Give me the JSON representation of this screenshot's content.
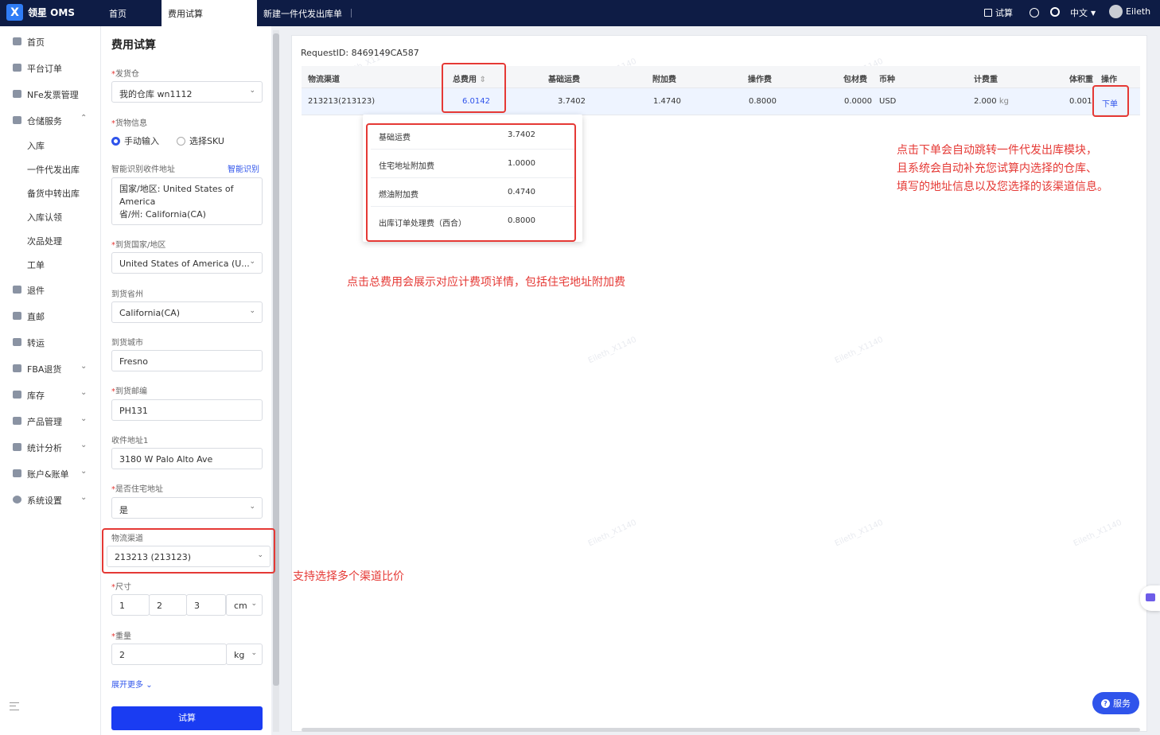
{
  "app": {
    "logo_mark": "X",
    "name": "领星 OMS"
  },
  "tabs": [
    {
      "label": "首页"
    },
    {
      "label": "费用试算",
      "active": true
    },
    {
      "label": "新建一件代发出库单"
    }
  ],
  "topright": {
    "calc_label": "试算",
    "lang": "中文",
    "user": "Eileth"
  },
  "sidebar": {
    "items": [
      {
        "label": "首页",
        "icon": "home-icon"
      },
      {
        "label": "平台订单",
        "icon": "order-icon"
      },
      {
        "label": "NFe发票管理",
        "icon": "invoice-icon"
      },
      {
        "label": "仓储服务",
        "icon": "warehouse-icon",
        "expanded": true
      },
      {
        "label": "入库"
      },
      {
        "label": "一件代发出库"
      },
      {
        "label": "备货中转出库"
      },
      {
        "label": "入库认领"
      },
      {
        "label": "次品处理"
      },
      {
        "label": "工单"
      },
      {
        "label": "退件",
        "icon": "return-icon"
      },
      {
        "label": "直邮",
        "icon": "mail-icon"
      },
      {
        "label": "转运",
        "icon": "transfer-icon"
      },
      {
        "label": "FBA退货",
        "icon": "fba-icon"
      },
      {
        "label": "库存",
        "icon": "inventory-icon"
      },
      {
        "label": "产品管理",
        "icon": "product-icon"
      },
      {
        "label": "统计分析",
        "icon": "stats-icon"
      },
      {
        "label": "账户&账单",
        "icon": "account-icon"
      },
      {
        "label": "系统设置",
        "icon": "settings-icon"
      }
    ]
  },
  "form": {
    "title": "费用试算",
    "warehouse_label": "发货仓",
    "warehouse_value": "我的仓库 wn1112",
    "goods_label": "货物信息",
    "radio_manual": "手动输入",
    "radio_sku": "选择SKU",
    "smart_label": "智能识别收件地址",
    "smart_link": "智能识别",
    "address_text": [
      "国家/地区: United States of",
      "America",
      "省/州: California(CA)"
    ],
    "country_label": "到货国家/地区",
    "country_value": "United States of America (U...",
    "state_label": "到货省州",
    "state_value": "California(CA)",
    "city_label": "到货城市",
    "city_value": "Fresno",
    "zip_label": "到货邮编",
    "zip_value": "PH131",
    "addr1_label": "收件地址1",
    "addr1_value": "3180 W Palo Alto Ave",
    "residential_label": "是否住宅地址",
    "residential_value": "是",
    "channel_label": "物流渠道",
    "channel_value": "213213 (213123)",
    "size_label": "尺寸",
    "size_l": "1",
    "size_w": "2",
    "size_h": "3",
    "size_unit": "cm",
    "weight_label": "重量",
    "weight_value": "2",
    "weight_unit": "kg",
    "expand_more": "展开更多",
    "calc_button": "试算"
  },
  "result": {
    "request_id": "RequestID: 8469149CA587",
    "columns": [
      "物流渠道",
      "总费用",
      "基础运费",
      "附加费",
      "操作费",
      "包材费",
      "币种",
      "计费重",
      "体积重",
      "操作"
    ],
    "row": {
      "channel": "213213(213123)",
      "total": "6.0142",
      "base": "3.7402",
      "surcharge": "1.4740",
      "operation": "0.8000",
      "packing": "0.0000",
      "currency": "USD",
      "charge_weight": "2.000",
      "charge_weight_unit": "kg",
      "volume_weight": "0.001",
      "action": "下单"
    },
    "fee_detail": [
      {
        "label": "基础运费",
        "value": "3.7402"
      },
      {
        "label": "住宅地址附加费",
        "value": "1.0000"
      },
      {
        "label": "燃油附加费",
        "value": "0.4740"
      },
      {
        "label": "出库订单处理费（西合）",
        "value": "0.8000"
      }
    ]
  },
  "annotations": {
    "order_note": [
      "点击下单会自动跳转一件代发出库模块，",
      "且系统会自动补充您试算内选择的仓库、",
      "填写的地址信息以及您选择的该渠道信息。"
    ],
    "fee_note": "点击总费用会展示对应计费项详情，包括住宅地址附加费",
    "channel_note": "支持选择多个渠道比价"
  },
  "service_button": "服务",
  "colors": {
    "accent": "#2f54eb",
    "topbar": "#0e1c45",
    "annotation": "#e53935"
  }
}
